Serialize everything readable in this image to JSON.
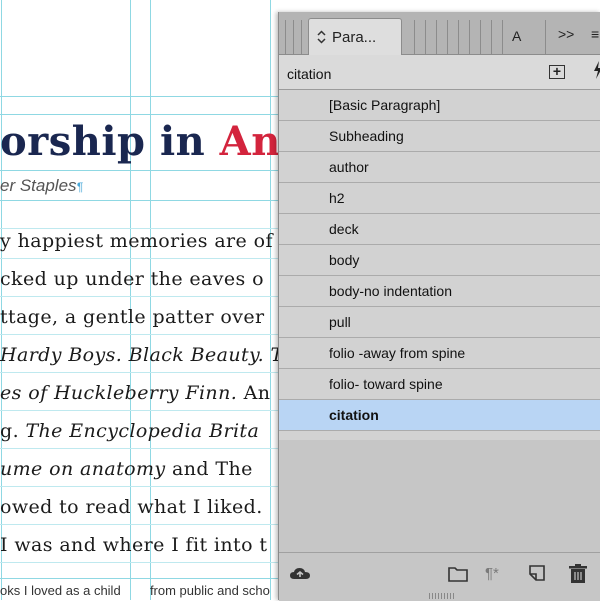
{
  "document": {
    "title_main": "orship in ",
    "title_accent": "An",
    "byline": "er Staples",
    "pilcrow": "¶",
    "lines": [
      {
        "pre": "y happiest memories are of",
        "it": "",
        "post": ""
      },
      {
        "pre": "cked up under the eaves o",
        "it": "",
        "post": ""
      },
      {
        "pre": "ttage, a gentle patter over",
        "it": "",
        "post": ""
      },
      {
        "pre": "",
        "it": "Hardy Boys. Black Beauty. Th",
        "post": ""
      },
      {
        "pre": "",
        "it": "es of Huckleberry Finn.",
        "post": " An"
      },
      {
        "pre": "g. ",
        "it": "The Encyclopedia Brita",
        "post": ""
      },
      {
        "pre": "",
        "it": "ume on anatomy",
        "post": " and The"
      },
      {
        "pre": "owed to read what I liked.",
        "it": "",
        "post": ""
      },
      {
        "pre": "I was and where I fit into t",
        "it": "",
        "post": ""
      }
    ],
    "footer_left": "oks I loved as a child",
    "footer_right": "from public and scho"
  },
  "panel": {
    "tab_chevron": "⌃⌄",
    "tab_label": "Para...",
    "tab_other": "A",
    "overflow": ">>",
    "menu_icon": "≡",
    "current_style": "citation",
    "new_group_label": "+",
    "quick_apply_icon": "lightning-icon",
    "styles": [
      {
        "label": "[Basic Paragraph]",
        "selected": false
      },
      {
        "label": "Subheading",
        "selected": false
      },
      {
        "label": "author",
        "selected": false
      },
      {
        "label": "h2",
        "selected": false
      },
      {
        "label": "deck",
        "selected": false
      },
      {
        "label": "body",
        "selected": false
      },
      {
        "label": "body-no indentation",
        "selected": false
      },
      {
        "label": "pull",
        "selected": false
      },
      {
        "label": "folio -away from spine",
        "selected": false
      },
      {
        "label": "folio- toward spine",
        "selected": false
      },
      {
        "label": "citation",
        "selected": true
      }
    ],
    "bottom_icons": [
      "cloud-library-icon",
      "folder-icon",
      "clear-overrides-icon",
      "new-style-icon",
      "trash-icon"
    ],
    "pilcrow_star": "¶*"
  },
  "colors": {
    "title": "#1a2750",
    "accent": "#d3243d",
    "selection": "#b9d5f4",
    "guides": "#8fd8e3"
  }
}
